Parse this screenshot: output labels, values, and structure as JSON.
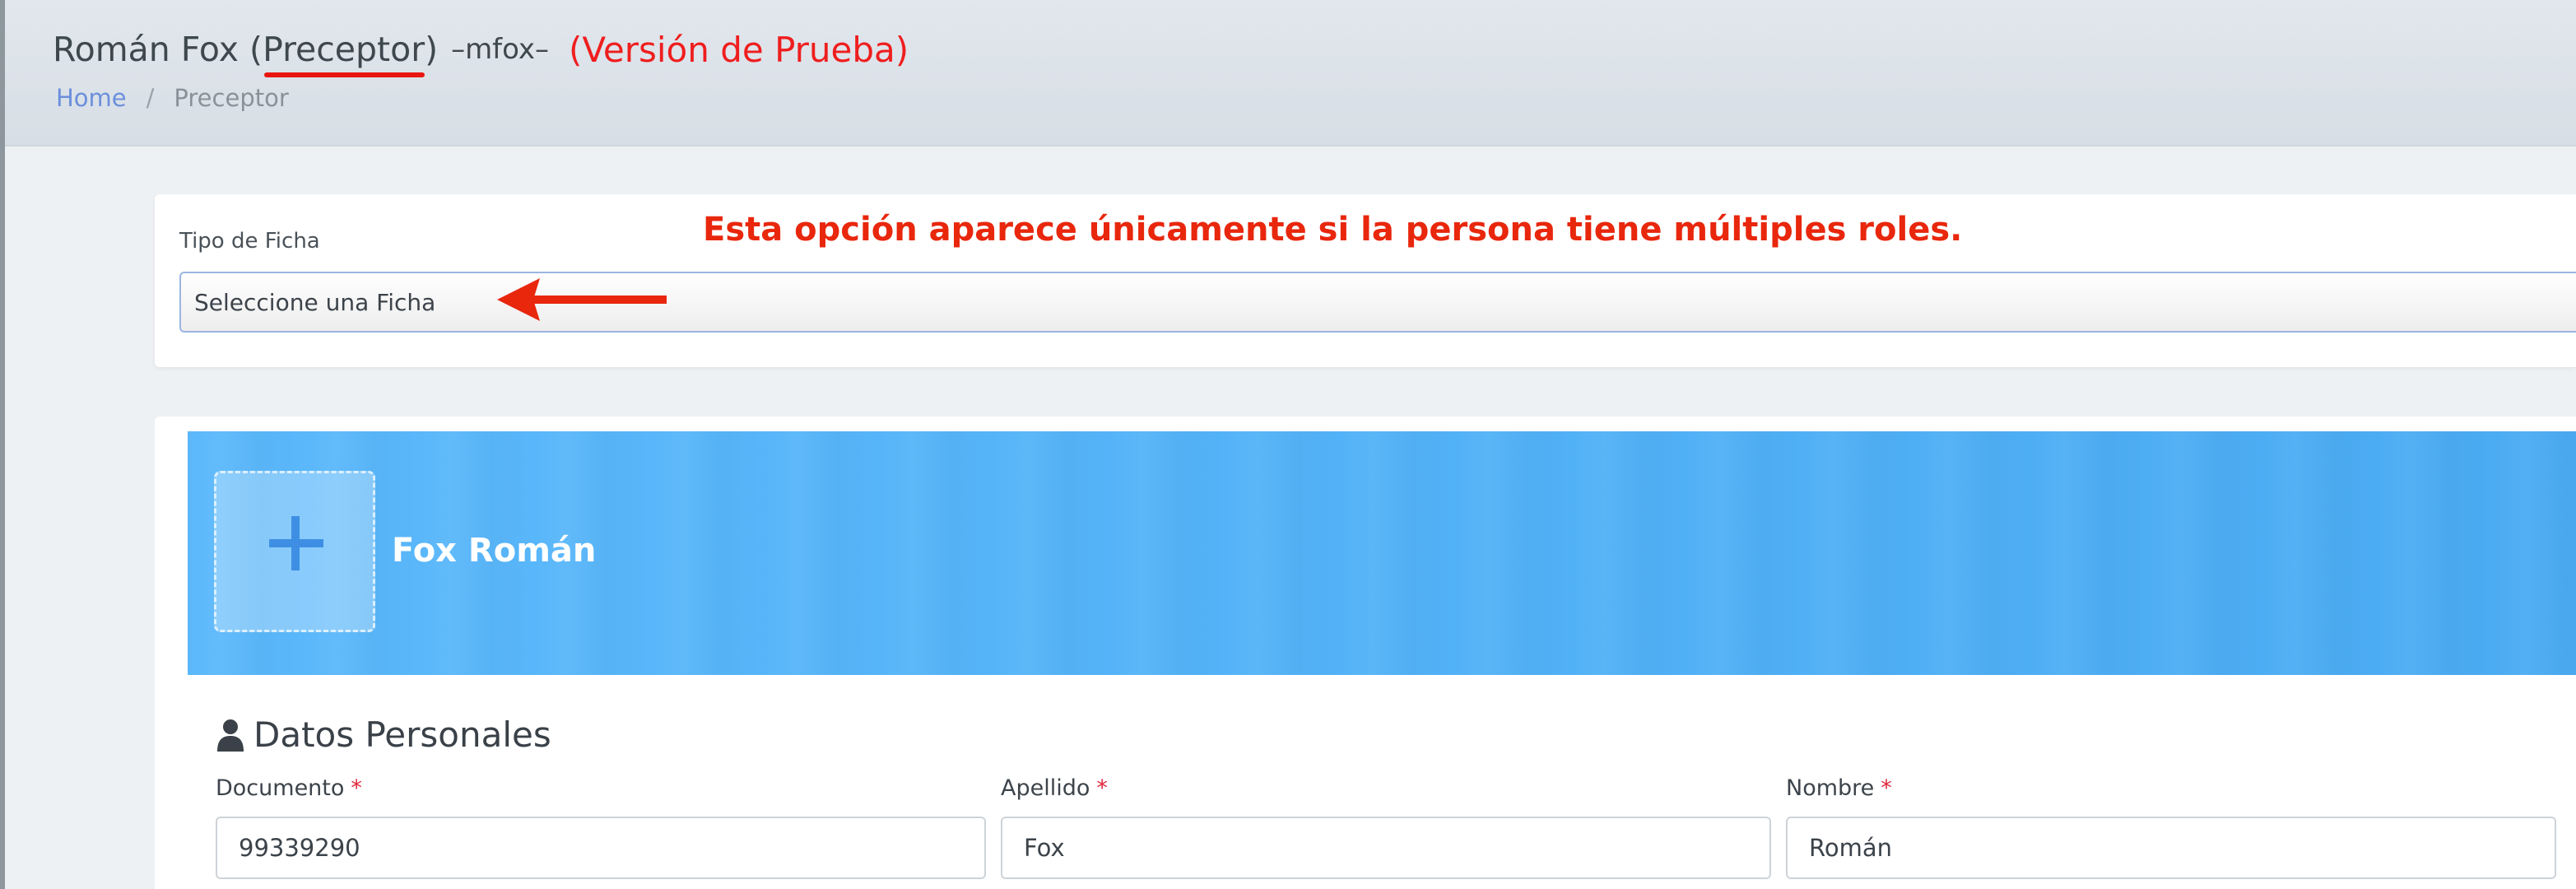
{
  "header": {
    "title_name": "Román Fox (",
    "title_role": "Preceptor",
    "title_close": ")",
    "title_user": "–mfox–",
    "title_version": "(Versión de Prueba)",
    "breadcrumb": {
      "home": "Home",
      "separator": "/",
      "current": "Preceptor"
    }
  },
  "tipo_ficha": {
    "label": "Tipo de Ficha",
    "selected": "Seleccione una Ficha",
    "annotation": "Esta opción aparece únicamente si la persona tiene múltiples roles."
  },
  "profile": {
    "name": "Fox Román",
    "avatar_icon": "plus-icon"
  },
  "datos_personales": {
    "section_title": "Datos Personales",
    "section_icon": "user-icon",
    "required_mark": "*",
    "fields": {
      "documento": {
        "label": "Documento",
        "value": "99339290"
      },
      "apellido": {
        "label": "Apellido",
        "value": "Fox"
      },
      "nombre": {
        "label": "Nombre",
        "value": "Román"
      }
    }
  },
  "colors": {
    "accent_blue": "#52b2f7",
    "annotation_red": "#e8270d",
    "required_red": "#e2263a",
    "link_blue": "#6c8fdc"
  }
}
